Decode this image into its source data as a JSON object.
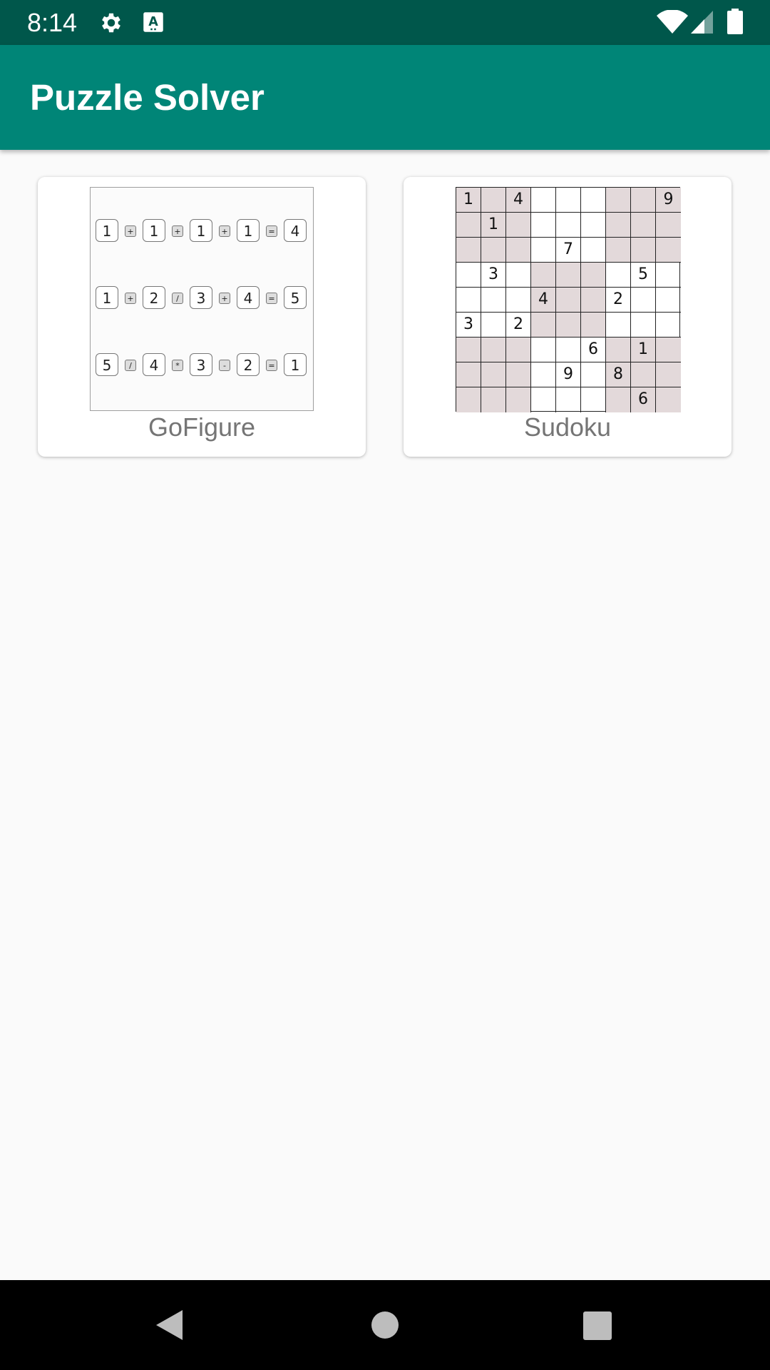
{
  "status_bar": {
    "time": "8:14",
    "icons": [
      "gear-icon",
      "a-icon",
      "wifi-icon",
      "signal-icon",
      "battery-icon"
    ]
  },
  "app_bar": {
    "title": "Puzzle Solver"
  },
  "puzzles": [
    {
      "label": "GoFigure",
      "thumbnail": {
        "rows": [
          [
            "1",
            "+",
            "1",
            "+",
            "1",
            "+",
            "1",
            "=",
            "4"
          ],
          [
            "1",
            "+",
            "2",
            "/",
            "3",
            "+",
            "4",
            "=",
            "5"
          ],
          [
            "5",
            "/",
            "4",
            "*",
            "3",
            "-",
            "2",
            "=",
            "1"
          ]
        ]
      }
    },
    {
      "label": "Sudoku",
      "thumbnail": {
        "cells": [
          [
            "1",
            "",
            "4",
            "",
            "",
            "",
            "",
            "",
            "9"
          ],
          [
            "",
            "1",
            "",
            "",
            "",
            "",
            "",
            "",
            ""
          ],
          [
            "",
            "",
            "",
            "",
            "7",
            "",
            "",
            "",
            ""
          ],
          [
            "",
            "3",
            "",
            "",
            "",
            "",
            "",
            "5",
            ""
          ],
          [
            "",
            "",
            "",
            "4",
            "",
            "",
            "2",
            "",
            ""
          ],
          [
            "3",
            "",
            "2",
            "",
            "",
            "",
            "",
            "",
            ""
          ],
          [
            "",
            "",
            "",
            "",
            "",
            "6",
            "",
            "1",
            ""
          ],
          [
            "",
            "",
            "",
            "",
            "9",
            "",
            "8",
            "",
            ""
          ],
          [
            "",
            "",
            "",
            "",
            "",
            "",
            "",
            "6",
            ""
          ]
        ]
      }
    }
  ],
  "colors": {
    "status_bar": "#00574b",
    "app_bar": "#008577",
    "card_label": "#757575",
    "sudoku_shade": "#e3d9da",
    "background": "#fafafa"
  },
  "nav_bar": {
    "icons": [
      "back-icon",
      "home-icon",
      "recents-icon"
    ]
  }
}
